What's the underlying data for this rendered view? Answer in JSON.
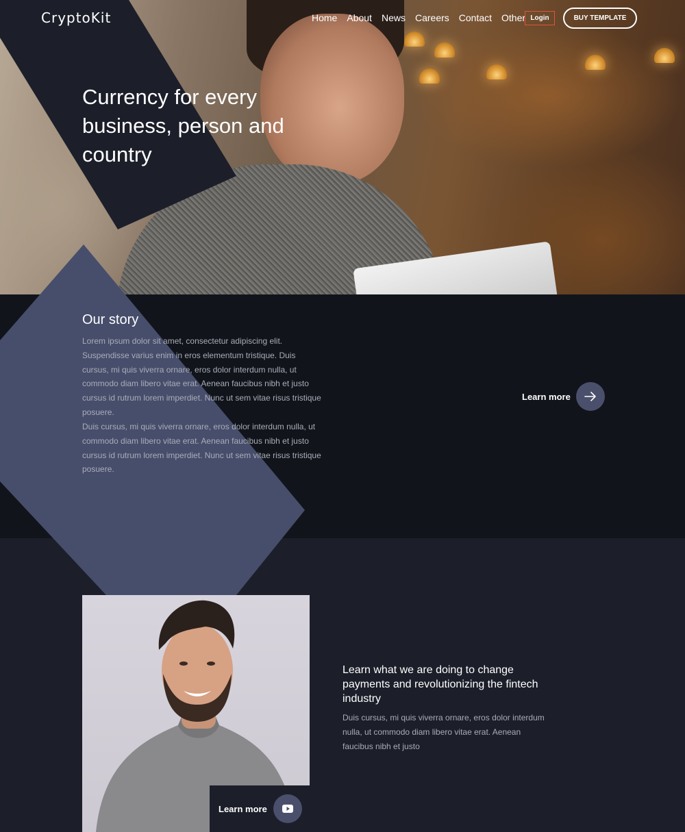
{
  "header": {
    "logo": "CryptoKit",
    "nav": [
      "Home",
      "About",
      "News",
      "Careers",
      "Contact",
      "Other"
    ],
    "login_label": "Login",
    "buy_label": "BUY TEMPLATE"
  },
  "hero": {
    "title": "Currency for every business, person and country"
  },
  "story": {
    "title": "Our story",
    "paragraph1": "Lorem ipsum dolor sit amet, consectetur adipiscing elit. Suspendisse varius enim in eros elementum tristique. Duis cursus, mi quis viverra ornare, eros dolor interdum nulla, ut commodo diam libero vitae erat. Aenean faucibus nibh et justo cursus id rutrum lorem imperdiet. Nunc ut sem vitae risus tristique posuere.",
    "paragraph2": "Duis cursus, mi quis viverra ornare, eros dolor interdum nulla, ut commodo diam libero vitae erat. Aenean faucibus nibh et justo cursus id rutrum lorem imperdiet. Nunc ut sem vitae risus tristique posuere.",
    "learn_more": "Learn more",
    "learn_more_icon": "arrow-right-icon"
  },
  "feature": {
    "title": "Learn what we are doing to change payments and revolutionizing the fintech industry",
    "paragraph": "Duis cursus, mi quis viverra ornare, eros dolor interdum nulla, ut commodo diam libero vitae erat. Aenean faucibus nibh et justo",
    "video_label": "Learn more",
    "video_icon": "youtube-play-icon"
  },
  "colors": {
    "hero_panel": "#1c1f2a",
    "diamond": "#474e6b",
    "story_bg": "#12141b",
    "feature_bg": "#1c1f2a",
    "login_border": "#e0553d",
    "circle_button": "#4a506c"
  }
}
